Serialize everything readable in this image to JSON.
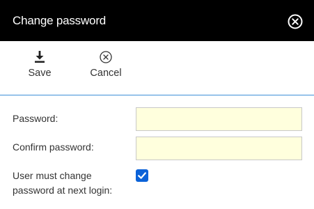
{
  "dialog": {
    "title": "Change password",
    "close_icon": "close-circle-icon"
  },
  "toolbar": {
    "save": {
      "label": "Save",
      "icon": "download-icon"
    },
    "cancel": {
      "label": "Cancel",
      "icon": "cancel-circle-icon"
    }
  },
  "form": {
    "password_label": "Password:",
    "password_value": "",
    "confirm_label": "Confirm password:",
    "confirm_value": "",
    "must_change_label_line1": "User must change",
    "must_change_label_line2": "password at next login:",
    "must_change_checked": true
  },
  "colors": {
    "titlebar": "#000000",
    "divider": "#3d8fd8",
    "input_bg": "#ffffdd",
    "checkbox": "#0b62d8"
  }
}
